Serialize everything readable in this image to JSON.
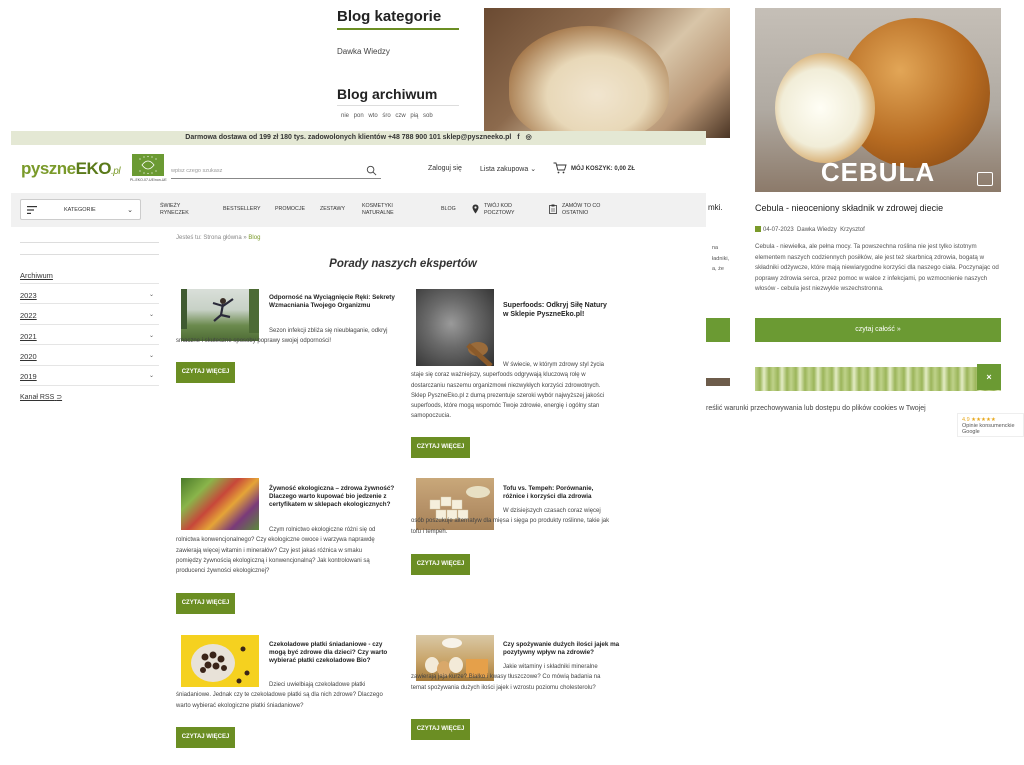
{
  "background": {
    "blog_categories": {
      "title": "Blog kategorie",
      "items": [
        "Dawka Wiedzy"
      ]
    },
    "blog_archive": {
      "title": "Blog archiwum",
      "weekdays": "nie pon wto śro czw pią sob"
    },
    "onion_post": {
      "image_caption": "CEBULA",
      "title": "Cebula - nieoceniony składnik w zdrowej diecie",
      "date": "04-07-2023",
      "category": "Dawka Wiedzy",
      "author": "Krzysztof",
      "excerpt": "Cebula - niewielka, ale pełna mocy. Ta powszechna roślina nie jest tylko istotnym elementem naszych codziennych posiłków, ale jest też skarbnicą zdrowia, bogatą w składniki odżywcze, które mają niewiarygodne korzyści dla naszego ciała. Poczynając od poprawy zdrowia serca, przez pomoc w walce z infekcjami, po wzmocnienie naszych włosów - cebula jest niezwykle wszechstronna.",
      "read_more": "czytaj całość »"
    },
    "fragment_title": "mki.",
    "fragment_lines": [
      "na",
      "ładniki,",
      "",
      "a, że"
    ],
    "cookies_text": "reślić warunki przechowywania lub dostępu do plików cookies w Twojej",
    "close_label": "×",
    "google_widget": {
      "rating": "4.9 ★★★★★",
      "line1": "Opinie konsumenckie",
      "line2": "Google"
    }
  },
  "topbar": {
    "text": "Darmowa dostawa od 199 zł   180 tys. zadowolonych klientów   +48 788 900 101   sklep@pyszneeko.pl"
  },
  "header": {
    "logo_main": "pyszne",
    "logo_eko": "EKO",
    "logo_pl": ".pl",
    "eu_badge_caption": "PL-EKO-07-UE/non-UE",
    "search_placeholder": "wpisz czego szukasz",
    "login": "Zaloguj się",
    "shopping_list": "Lista zakupowa",
    "cart": "MÓJ KOSZYK: 0,00 ZŁ"
  },
  "nav": {
    "categories": "KATEGORIE",
    "items": [
      {
        "l1": "ŚWIEŻY",
        "l2": "RYNECZEK"
      },
      {
        "l1": "BESTSELLERY",
        "l2": ""
      },
      {
        "l1": "PROMOCJE",
        "l2": ""
      },
      {
        "l1": "ZESTAWY",
        "l2": ""
      },
      {
        "l1": "KOSMETYKI",
        "l2": "NATURALNE"
      },
      {
        "l1": "BLOG",
        "l2": ""
      },
      {
        "l1": "TWÓJ KOD",
        "l2": "POCZTOWY"
      },
      {
        "l1": "ZAMÓW TO CO",
        "l2": "OSTATNIO"
      }
    ]
  },
  "sidebar": {
    "archive_title": "Archiwum",
    "years": [
      "2023",
      "2022",
      "2021",
      "2020",
      "2019"
    ],
    "rss": "Kanał RSS"
  },
  "breadcrumb": {
    "prefix": "Jesteś tu:",
    "home": "Strona główna",
    "sep": "»",
    "current": "Blog"
  },
  "page_title": "Porady naszych ekspertów",
  "posts": [
    {
      "title": "Odporność na Wyciągnięcie Ręki: Sekrety Wzmacniania Twojego Organizmu",
      "desc": "Sezon infekcji zbliża się nieubłaganie, odkryj smaczne i skuteczne sposoby poprawy swojej odporności!",
      "button": "CZYTAJ WIĘCEJ"
    },
    {
      "title": "Superfoods: Odkryj Siłę Natury w Sklepie PyszneEko.pl!",
      "desc": "W świecie, w którym zdrowy styl życia staje się coraz ważniejszy, superfoods odgrywają kluczową rolę w dostarczaniu naszemu organizmowi niezwykłych korzyści zdrowotnych. Sklep PyszneEko.pl z dumą prezentuje szeroki wybór najwyższej jakości superfoods, które mogą wspomóc Twoje zdrowie, energię i ogólny stan samopoczucia.",
      "button": "CZYTAJ WIĘCEJ"
    },
    {
      "title": "Żywność ekologiczna – zdrowa żywność? Dlaczego warto kupować bio jedzenie z certyfikatem w sklepach ekologicznych?",
      "desc": "Czym rolnictwo ekologiczne różni się od rolnictwa konwencjonalnego? Czy ekologiczne owoce i warzywa naprawdę zawierają więcej witamin i minerałów? Czy jest jakaś różnica w smaku pomiędzy żywnością ekologiczną i konwencjonalną? Jak kontrolowani są producenci żywności ekologicznej?",
      "button": "CZYTAJ WIĘCEJ"
    },
    {
      "title": "Tofu vs. Tempeh: Porównanie, różnice i korzyści dla zdrowia",
      "desc": "W dzisiejszych czasach coraz więcej osób poszukuje alternatyw dla mięsa i sięga po produkty roślinne, takie jak tofu i tempeh.",
      "button": "CZYTAJ WIĘCEJ"
    },
    {
      "title": "Czekoladowe płatki śniadaniowe - czy mogą być zdrowe dla dzieci? Czy warto wybierać płatki czekoladowe Bio?",
      "desc": "Dzieci uwielbiają czekoladowe płatki śniadaniowe. Jednak czy te czekoladowe płatki są dla nich zdrowe? Dlaczego warto wybierać ekologiczne płatki śniadaniowe?",
      "button": "CZYTAJ WIĘCEJ"
    },
    {
      "title": "Czy spożywanie dużych ilości jajek ma pozytywny wpływ na zdrowie?",
      "desc": "Jakie witaminy i składniki mineralne zawierają jaja kurze? Białko i kwasy tłuszczowe? Co mówią badania na temat spożywania dużych ilości jajek i wzrostu poziomu cholesterolu?",
      "button": "CZYTAJ WIĘCEJ"
    }
  ],
  "colors": {
    "brand_green": "#7a9a2a",
    "button_green": "#6b8e23",
    "topbar_bg": "#e4e8d4"
  }
}
